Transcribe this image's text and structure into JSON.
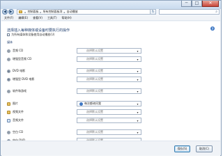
{
  "window": {
    "controls": {
      "minimize": "─",
      "maximize": "□",
      "close": "✕"
    }
  },
  "address": {
    "back": "◀",
    "forward": "▶",
    "breadcrumb": [
      "控制面板",
      "所有控制面板项",
      "自动播放"
    ],
    "separator": "▸",
    "refresh": "↻",
    "search_icon": "⌕"
  },
  "menu": [
    "文件(F)",
    "编辑(E)",
    "查看(V)",
    "工具(T)",
    "帮助(H)"
  ],
  "main": {
    "heading": "选择插入每种媒体或设备时要执行的操作",
    "use_autoplay_label": "为所有媒体和设备使用自动播放(U)",
    "help": "?",
    "section_title": "媒体",
    "rows": [
      {
        "label": "音频 CD",
        "value": "选择默认设置",
        "icon": "cd-icon"
      },
      {
        "label": "增强型音频 CD",
        "value": "选择默认设置",
        "icon": "cd-icon"
      },
      {
        "label": "DVD 电影",
        "value": "选择默认设置",
        "icon": "dvd-icon"
      },
      {
        "label": "增强型 DVD 电影",
        "value": "选择默认设置",
        "icon": "dvd-icon"
      },
      {
        "label": "软件和游戏",
        "value": "选择默认设置",
        "icon": "software-icon"
      },
      {
        "label": "图片",
        "value": "每次都询问我",
        "icon": "picture-icon"
      },
      {
        "label": "视频文件",
        "value": "选择默认设置",
        "icon": "video-icon"
      },
      {
        "label": "音频文件",
        "value": "选择默认设置",
        "icon": "music-icon"
      },
      {
        "label": "空白 CD",
        "value": "选择默认设置",
        "icon": "cd-icon"
      },
      {
        "label": "空白 DVD",
        "value": "选择默认设置",
        "icon": "dvd-icon"
      }
    ],
    "chevron": "▾"
  },
  "footer": {
    "save_label": "保存(S)",
    "cancel_label": "取消(C)"
  }
}
